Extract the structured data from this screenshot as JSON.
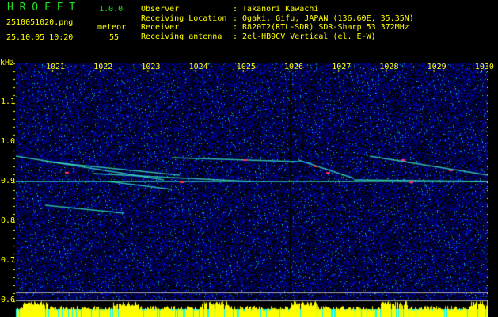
{
  "app": {
    "name": "H R O F F T",
    "version": "1.0.0"
  },
  "file": {
    "name": "2510051020.png",
    "datetime": "25.10.05 10:20",
    "count_label": "meteor",
    "count": "55"
  },
  "info": [
    {
      "label": "Observer",
      "value": ": Takanori Kawachi"
    },
    {
      "label": "Receiving Location",
      "value": ": Ogaki, Gifu, JAPAN (136.60E, 35.35N)"
    },
    {
      "label": "Receiver",
      "value": ": R820T2(RTL-SDR) SDR-Sharp 53.372MHz"
    },
    {
      "label": "Receiving antenna",
      "value": ": 2el-HB9CV Vertical (el. E-W)"
    }
  ],
  "axis": {
    "unit": "kHz",
    "x_ticks": [
      "1021",
      "1022",
      "1023",
      "1024",
      "1025",
      "1026",
      "1027",
      "1028",
      "1029",
      "1030"
    ],
    "y_ticks": [
      "1.1",
      "1.0",
      "0.9",
      "0.8",
      "0.7",
      "0.6"
    ]
  },
  "colors": {
    "text": "#ffff00",
    "title": "#20e020",
    "background": "#000010",
    "noise": "#1020c0",
    "histogram": "#ffff00",
    "histogram_base": "#00ffff"
  }
}
